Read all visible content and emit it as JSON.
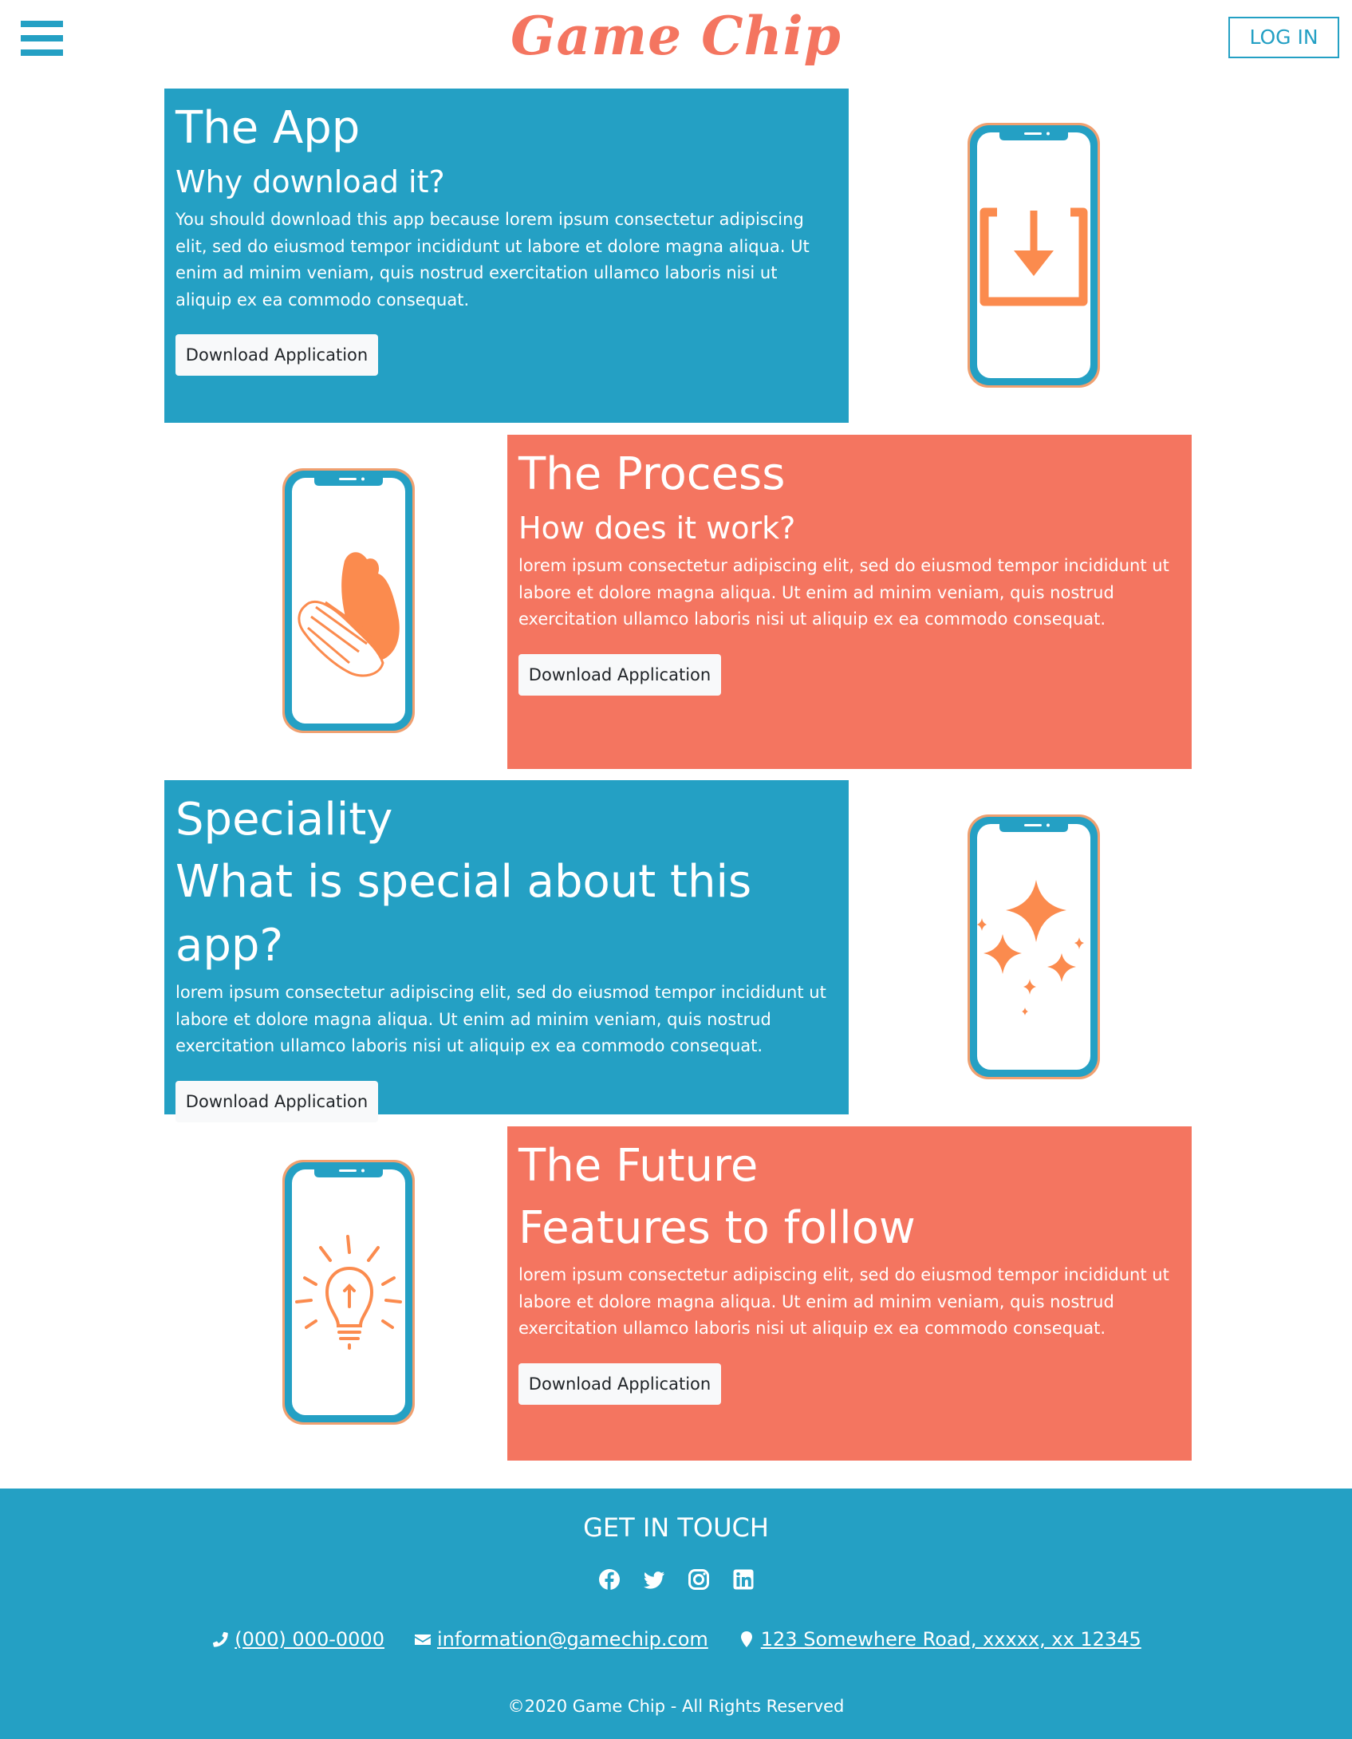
{
  "header": {
    "logo": "Game Chip",
    "login_label": "LOG IN"
  },
  "sections": [
    {
      "title": "The App",
      "subtitle": "Why download it?",
      "body": "You should download this app because lorem ipsum consectetur adipiscing elit, sed do eiusmod tempor incididunt ut labore et dolore magna aliqua. Ut enim ad minim veniam, quis nostrud exercitation ullamco laboris nisi ut aliquip ex ea commodo consequat.",
      "button": "Download Application",
      "icon": "download-icon"
    },
    {
      "title": "The Process",
      "subtitle": "How does it work?",
      "body": "lorem ipsum consectetur adipiscing elit, sed do eiusmod tempor incididunt ut labore et dolore magna aliqua. Ut enim ad minim veniam, quis nostrud exercitation ullamco laboris nisi ut aliquip ex ea commodo consequat.",
      "button": "Download Application",
      "icon": "hands-icon"
    },
    {
      "title": "Speciality",
      "subtitle": "What is special about this app?",
      "body": "lorem ipsum consectetur adipiscing elit, sed do eiusmod tempor incididunt ut labore et dolore magna aliqua. Ut enim ad minim veniam, quis nostrud exercitation ullamco laboris nisi ut aliquip ex ea commodo consequat.",
      "button": "Download Application",
      "icon": "sparkles-icon"
    },
    {
      "title": "The Future",
      "subtitle": "Features to follow",
      "body": "lorem ipsum consectetur adipiscing elit, sed do eiusmod tempor incididunt ut labore et dolore magna aliqua. Ut enim ad minim veniam, quis nostrud exercitation ullamco laboris nisi ut aliquip ex ea commodo consequat.",
      "button": "Download Application",
      "icon": "lightbulb-icon"
    }
  ],
  "footer": {
    "title": "GET IN TOUCH",
    "social_icons": [
      "facebook-icon",
      "twitter-icon",
      "instagram-icon",
      "linkedin-icon"
    ],
    "phone": " (000) 000-0000",
    "email": " information@gamechip.com",
    "address": " 123 Somewhere Road, xxxxx, xx 12345",
    "copyright": "©2020 Game Chip - All Rights Reserved"
  },
  "colors": {
    "blue": "#24a0c4",
    "coral": "#f47560",
    "orange": "#fb8b4e",
    "white": "#ffffff"
  }
}
